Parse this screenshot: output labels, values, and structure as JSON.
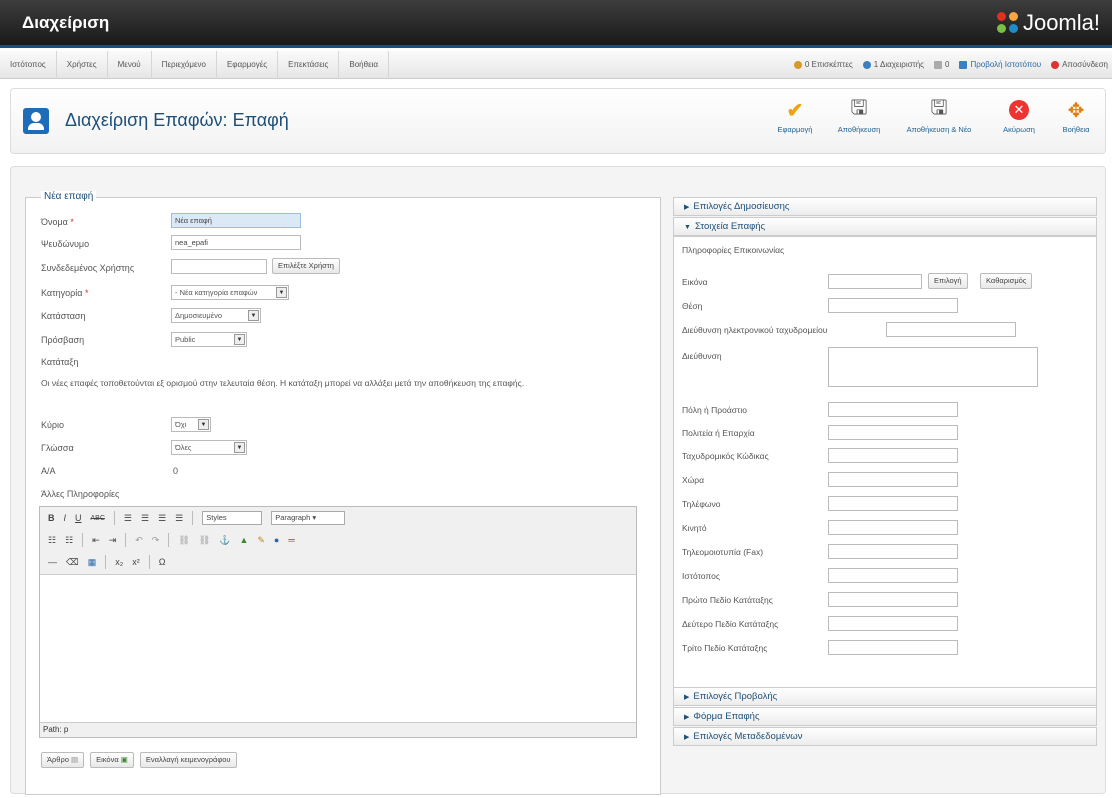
{
  "header": {
    "title": "Διαχείριση",
    "logo_text": "Joomla!"
  },
  "menu": {
    "items": [
      "Ιστότοπος",
      "Χρήστες",
      "Μενού",
      "Περιεχόμενο",
      "Εφαρμογές",
      "Επεκτάσεις",
      "Βοήθεια"
    ],
    "visitors": "0 Επισκέπτες",
    "admins": "1 Διαχειριστής",
    "messages": "0",
    "preview": "Προβολή Ιστοτόπου",
    "logout": "Αποσύνδεση"
  },
  "toolbar": {
    "title": "Διαχείριση Επαφών: Επαφή",
    "apply": "Εφαρμογή",
    "save": "Αποθήκευση",
    "save_new": "Αποθήκευση & Νέο",
    "cancel": "Ακύρωση",
    "help": "Βοήθεια"
  },
  "form": {
    "legend": "Νέα επαφή",
    "name_label": "Όνομα",
    "name_value": "Νέα επαφή",
    "alias_label": "Ψευδώνυμο",
    "alias_value": "nea_epafi",
    "linked_user_label": "Συνδεδεμένος Χρήστης",
    "select_user_button": "Επιλέξτε Χρήστη",
    "category_label": "Κατηγορία",
    "category_value": "- Νέα κατηγορία επαφών",
    "state_label": "Κατάσταση",
    "state_value": "Δημοσιευμένο",
    "access_label": "Πρόσβαση",
    "access_value": "Public",
    "ordering_label": "Κατάταξη",
    "ordering_note": "Οι νέες επαφές τοποθετούνται εξ ορισμού στην τελευταία θέση. Η κατάταξη μπορεί να αλλάξει μετά την αποθήκευση της επαφής.",
    "featured_label": "Κύριο",
    "featured_value": "Όχι",
    "language_label": "Γλώσσα",
    "language_value": "Όλες",
    "id_label": "Α/Α",
    "id_value": "0",
    "misc_label": "Άλλες Πληροφορίες"
  },
  "editor": {
    "styles": "Styles",
    "paragraph": "Paragraph",
    "path": "Path: p",
    "btn_article": "Άρθρο",
    "btn_image": "Εικόνα",
    "btn_toggle": "Εναλλαγή κειμενογράφου"
  },
  "right": {
    "publishing": "Επιλογές Δημοσίευσης",
    "details": "Στοιχεία Επαφής",
    "contact_info": "Πληροφορίες Επικοινωνίας",
    "image_label": "Εικόνα",
    "select_btn": "Επιλογή",
    "clear_btn": "Καθαρισμός",
    "fields": [
      "Θέση",
      "Διεύθυνση ηλεκτρονικού ταχυδρομείου",
      "Διεύθυνση",
      "Πόλη ή Προάστιο",
      "Πολιτεία ή Επαρχία",
      "Ταχυδρομικός Κώδικας",
      "Χώρα",
      "Τηλέφωνο",
      "Κινητό",
      "Τηλεομοιοτυπία (Fax)",
      "Ιστότοπος",
      "Πρώτο Πεδίο Κατάταξης",
      "Δεύτερο Πεδίο Κατάταξης",
      "Τρίτο Πεδίο Κατάταξης"
    ],
    "display": "Επιλογές Προβολής",
    "contact_form": "Φόρμα Επαφής",
    "metadata": "Επιλογές Μεταδεδομένων"
  }
}
